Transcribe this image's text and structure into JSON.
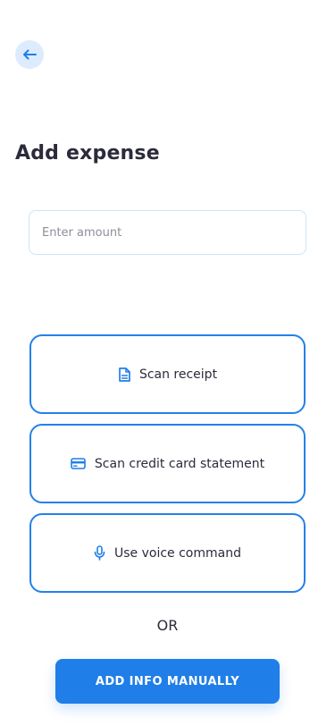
{
  "header": {
    "back_icon": "arrow-left-icon"
  },
  "page": {
    "title": "Add expense"
  },
  "amount": {
    "placeholder": "Enter amount",
    "value": ""
  },
  "options": [
    {
      "label": "Scan receipt",
      "icon": "document-icon"
    },
    {
      "label": "Scan credit card statement",
      "icon": "credit-card-icon"
    },
    {
      "label": "Use voice command",
      "icon": "microphone-icon"
    }
  ],
  "divider_text": "OR",
  "manual_button": {
    "label": "ADD INFO MANUALLY"
  },
  "colors": {
    "accent": "#1f7ee8",
    "accent_light": "#dcebfd",
    "text": "#2b2b3b"
  }
}
